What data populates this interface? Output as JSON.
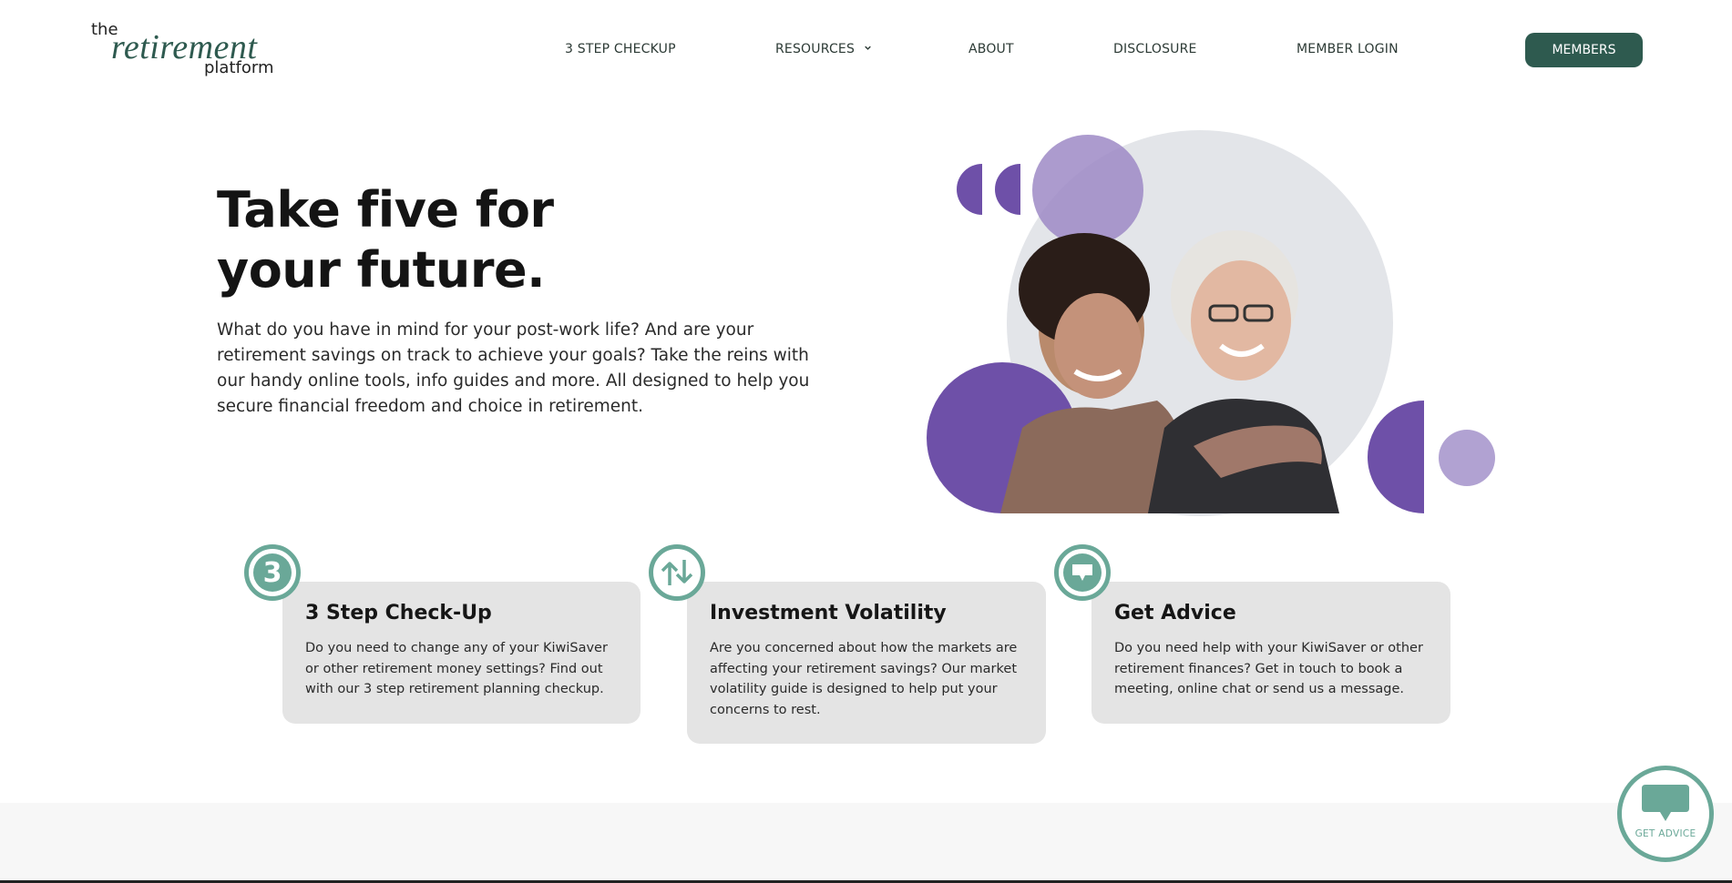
{
  "logo": {
    "the": "the",
    "retirement": "retirement",
    "platform": "platform"
  },
  "nav": {
    "items": [
      {
        "label": "3 STEP CHECKUP"
      },
      {
        "label": "RESOURCES"
      },
      {
        "label": "ABOUT"
      },
      {
        "label": "DISCLOSURE"
      },
      {
        "label": "MEMBER LOGIN"
      }
    ],
    "members_label": "MEMBERS"
  },
  "hero": {
    "title": "Take five for\nyour future.",
    "body": "What do you have in mind for your post-work life? And are your retirement savings on track to achieve your goals? Take the reins with our handy online tools, info guides and more. All designed to help you secure financial freedom and choice in retirement."
  },
  "cards": [
    {
      "badge": "3",
      "title": "3 Step Check-Up",
      "text": "Do you need to change any of your KiwiSaver or other retirement money settings? Find out with our 3 step retirement planning checkup."
    },
    {
      "badge": "",
      "title": "Investment Volatility",
      "text": "Are you concerned about how the markets are affecting your retirement savings?  Our market volatility guide is designed to help put your concerns to rest."
    },
    {
      "badge": "",
      "title": "Get Advice",
      "text": "Do you need help with your KiwiSaver or other retirement finances? Get in touch to book a meeting, online chat or send us a message."
    }
  ],
  "fab": {
    "label": "GET ADVICE"
  },
  "colors": {
    "brand_green": "#2e5a4f",
    "accent_teal": "#6aa898",
    "purple_dark": "#6e50a8",
    "purple_light": "#b1a2d2",
    "card_bg": "#e4e4e4",
    "circle_grey": "#e3e5e9"
  },
  "icons": {
    "resources_chevron": "chevron-down-icon",
    "card_1": "number-three-icon",
    "card_2": "swap-arrows-icon",
    "card_3": "chat-bubble-icon",
    "fab": "chat-bubble-icon"
  }
}
